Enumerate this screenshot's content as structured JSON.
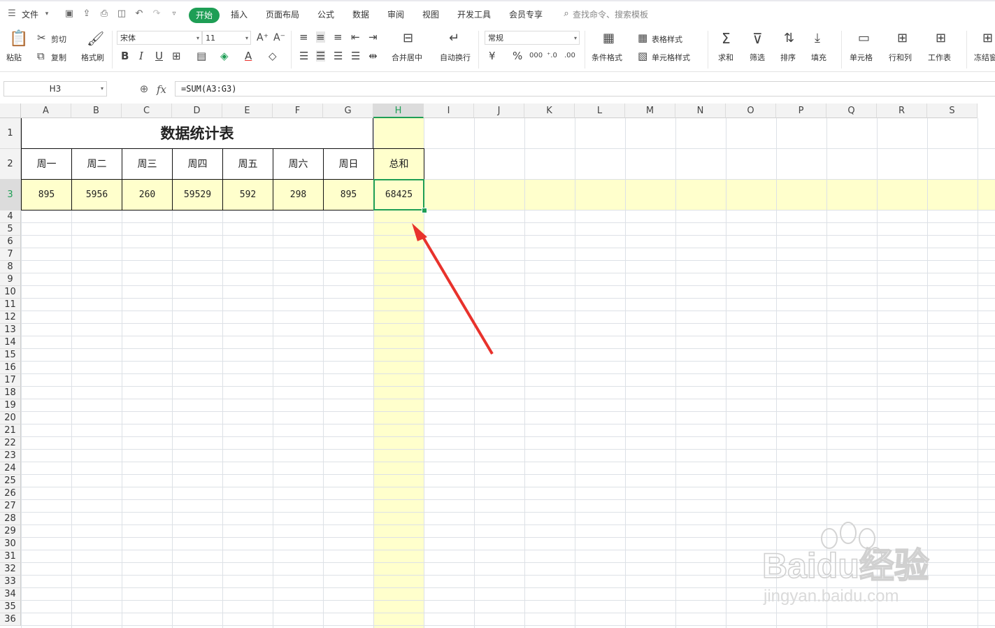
{
  "menubar": {
    "file_label": "文件",
    "tabs": [
      "开始",
      "插入",
      "页面布局",
      "公式",
      "数据",
      "审阅",
      "视图",
      "开发工具",
      "会员专享"
    ],
    "search_placeholder": "查找命令、搜索模板"
  },
  "ribbon": {
    "paste": "粘贴",
    "cut": "剪切",
    "copy": "复制",
    "format_painter": "格式刷",
    "font_name": "宋体",
    "font_size": "11",
    "merge_center": "合并居中",
    "wrap_text": "自动换行",
    "number_format": "常规",
    "conditional_format": "条件格式",
    "table_style": "表格样式",
    "cell_style": "单元格样式",
    "sum": "求和",
    "filter": "筛选",
    "sort": "排序",
    "fill": "填充",
    "cell": "单元格",
    "rows_cols": "行和列",
    "worksheet": "工作表",
    "freeze": "冻结窗"
  },
  "formula_bar": {
    "cell_ref": "H3",
    "fx": "fx",
    "formula": "=SUM(A3:G3)"
  },
  "sheet": {
    "columns": [
      "A",
      "B",
      "C",
      "D",
      "E",
      "F",
      "G",
      "H",
      "I",
      "J",
      "K",
      "L",
      "M",
      "N",
      "O",
      "P",
      "Q",
      "R",
      "S"
    ],
    "rows": [
      "1",
      "2",
      "3",
      "4",
      "5",
      "6",
      "7",
      "8",
      "9",
      "10",
      "11",
      "12",
      "13",
      "14",
      "15",
      "16",
      "17",
      "18",
      "19",
      "20",
      "21",
      "22",
      "23",
      "24",
      "25",
      "26",
      "27",
      "28",
      "29",
      "30",
      "31",
      "32",
      "33",
      "34",
      "35",
      "36"
    ],
    "title": "数据统计表",
    "headers": [
      "周一",
      "周二",
      "周三",
      "周四",
      "周五",
      "周六",
      "周日",
      "总和"
    ],
    "values": [
      "895",
      "5956",
      "260",
      "59529",
      "592",
      "298",
      "895",
      "68425"
    ],
    "selected_cell": "H3",
    "highlight_color": "#ffffcc",
    "selection_color": "#1e9e55",
    "arrow_color": "#e8322c"
  },
  "watermark": {
    "brand": "Baidu经验",
    "url": "jingyan.baidu.com"
  }
}
